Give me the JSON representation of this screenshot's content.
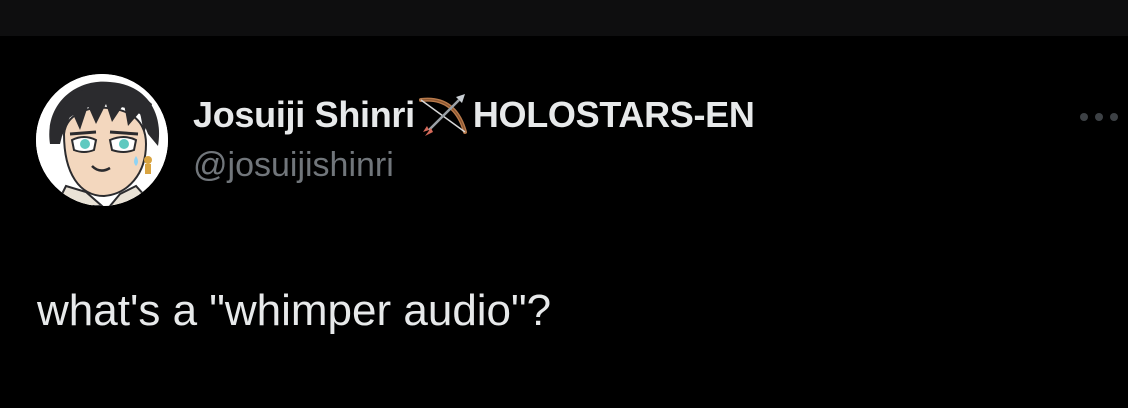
{
  "tweet": {
    "author": {
      "display_name": "Josuiji Shinri",
      "name_emoji": "bow-and-arrow-icon",
      "affiliation": "HOLOSTARS-EN",
      "handle": "@josuijishinri",
      "avatar": "avatar-illustration"
    },
    "text": "what's a \"whimper audio\"?",
    "more_menu_icon": "more-dots-icon"
  },
  "colors": {
    "background": "#000000",
    "top_bar": "#0e0e0f",
    "primary_text": "#e7e9ea",
    "secondary_text": "#71767b",
    "more_icon": "#3d4145"
  }
}
